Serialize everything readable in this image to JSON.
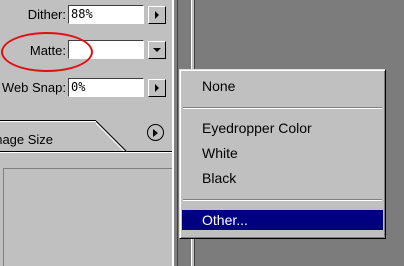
{
  "palette": {
    "dither_label": "Dither:",
    "dither_value": "88%",
    "matte_label": "Matte:",
    "matte_value": "",
    "websnap_label": "Web Snap:",
    "websnap_value": "0%",
    "tab_label": "Image Size"
  },
  "menu": {
    "items": [
      "None",
      "Eyedropper Color",
      "White",
      "Black",
      "Other..."
    ],
    "selected": "Other..."
  },
  "colors": {
    "highlight_ring": "#e01010",
    "selection": "#000080"
  }
}
